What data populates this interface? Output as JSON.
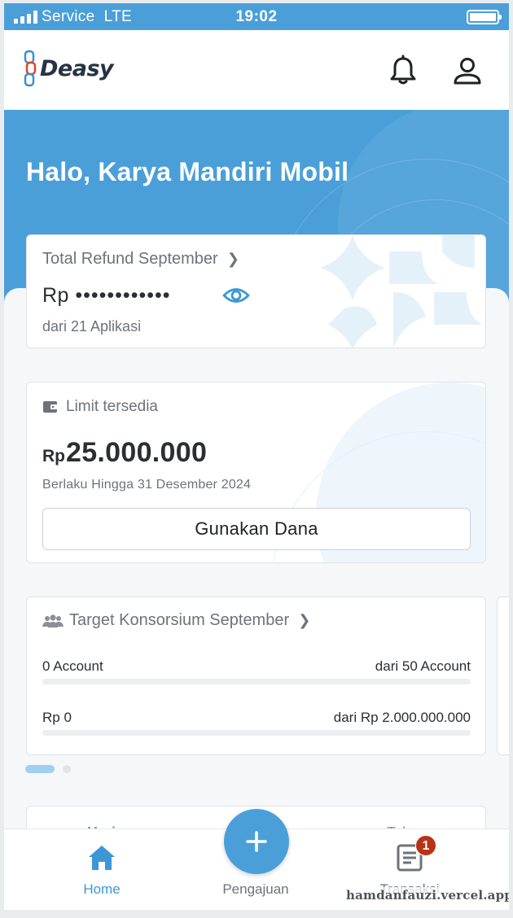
{
  "status_bar": {
    "carrier": "Service",
    "network": "LTE",
    "time": "19:02"
  },
  "header": {
    "logo_text": "Deasy",
    "icons": [
      "bell-icon",
      "profile-icon"
    ]
  },
  "hero": {
    "greeting": "Halo, Karya Mandiri Mobil"
  },
  "refund_card": {
    "title": "Total Refund September",
    "currency": "Rp",
    "masked_amount": "••••••••••••",
    "subtitle": "dari 21 Aplikasi"
  },
  "limit_card": {
    "title": "Limit tersedia",
    "currency": "Rp",
    "amount": "25.000.000",
    "validity": "Berlaku Hingga 31 Desember 2024",
    "button_label": "Gunakan Dana"
  },
  "target_card": {
    "title": "Target Konsorsium September",
    "accounts_current": "0 Account",
    "accounts_target": "dari 50 Account",
    "accounts_progress": 0,
    "amount_current": "Rp 0",
    "amount_target": "dari Rp 2.000.000.000",
    "amount_progress": 0
  },
  "carousel": {
    "page": 1,
    "pages": 2
  },
  "period_tabs": {
    "left": "Hari",
    "right": "Tahun"
  },
  "bottom_nav": {
    "items": [
      {
        "label": "Home",
        "icon": "home-icon",
        "active": true
      },
      {
        "label": "Pengajuan",
        "icon": "plus-icon",
        "active": false
      },
      {
        "label": "Transaksi",
        "icon": "document-icon",
        "active": false
      }
    ],
    "badge_count": "1"
  },
  "watermark": "hamdanfauzi.vercel.app",
  "colors": {
    "primary": "#4a9fd9",
    "text": "#2b2f33",
    "muted": "#6c737a",
    "badge": "#b83218"
  }
}
